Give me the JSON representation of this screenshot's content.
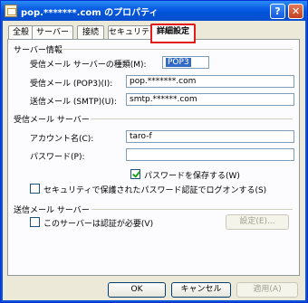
{
  "window": {
    "title": "pop.*******.com のプロパティ",
    "help_label": "?",
    "close_label": "✕"
  },
  "tabs": [
    {
      "label": "全般"
    },
    {
      "label": "サーバー"
    },
    {
      "label": "接続"
    },
    {
      "label": "セキュリティ"
    },
    {
      "label": "詳細設定"
    }
  ],
  "server_info": {
    "group_label": "サーバー情報",
    "incoming_type_label": "受信メール サーバーの種類(M):",
    "incoming_type_value": "POP3",
    "incoming_pop3_label": "受信メール (POP3)(I):",
    "incoming_pop3_value": "pop.*******.com",
    "outgoing_smtp_label": "送信メール (SMTP)(U):",
    "outgoing_smtp_value": "smtp.******.com"
  },
  "incoming_server": {
    "group_label": "受信メール サーバー",
    "account_label": "アカウント名(C):",
    "account_value": "taro-f",
    "password_label": "パスワード(P):",
    "password_value": "",
    "save_password_label": "パスワードを保存する(W)",
    "save_password_checked": true,
    "spa_label": "セキュリティで保護されたパスワード認証でログオンする(S)",
    "spa_checked": false
  },
  "outgoing_server": {
    "group_label": "送信メール サーバー",
    "auth_required_label": "このサーバーは認証が必要(V)",
    "auth_required_checked": false,
    "settings_button": "設定(E)..."
  },
  "buttons": {
    "ok": "OK",
    "cancel": "キャンセル",
    "apply": "適用(A)"
  }
}
